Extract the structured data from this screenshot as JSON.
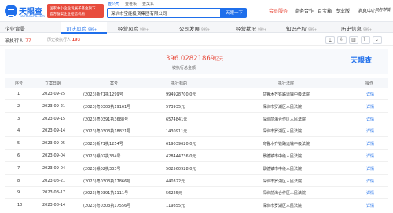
{
  "header": {
    "logo_name": "天眼查",
    "logo_domain": "TianYanCha.com",
    "promo_line1": "国家中小企业发展子基金旗下",
    "promo_line2": "官方备案企业征信机构",
    "search_tabs": [
      "查公司",
      "查老板",
      "查关系"
    ],
    "search_value": "深圳市宝能投资集团有限公司",
    "search_button": "天眼一下",
    "nav_vip": "会员服务",
    "nav_items": [
      "商务合作",
      "百宝箱",
      "专业版",
      "消息中心"
    ],
    "user_name": "马尔萨斯"
  },
  "tabs": [
    {
      "label": "企业背景",
      "count": ""
    },
    {
      "label": "司法风险",
      "count": "999+"
    },
    {
      "label": "经营风险",
      "count": "999+"
    },
    {
      "label": "公司发展",
      "count": "999+"
    },
    {
      "label": "经营状况",
      "count": "999+"
    },
    {
      "label": "知识产权",
      "count": "999+"
    },
    {
      "label": "历史信息",
      "count": "999+"
    }
  ],
  "subbar": {
    "title": "被执行人",
    "count": "77",
    "history_label": "历史被执行人",
    "history_count": "193"
  },
  "summary": {
    "amount": "396.02821869",
    "unit": "亿元",
    "label": "被执行总金额",
    "brand": "天眼查"
  },
  "table": {
    "headers": [
      "序号",
      "立案日期",
      "案号",
      "执行标的",
      "执行法院",
      "操作"
    ],
    "rows": [
      {
        "idx": "1",
        "date": "2023-09-25",
        "case": "(2023)新71执1299号",
        "amount": "994928700.0元",
        "court": "乌鲁木齐铁路运输中级法院",
        "link": "详情"
      },
      {
        "idx": "2",
        "date": "2023-09-21",
        "case": "(2023)粤0303执19161号",
        "amount": "573935元",
        "court": "深圳市罗湖区人民法院",
        "link": "详情"
      },
      {
        "idx": "3",
        "date": "2023-09-15",
        "case": "(2023)粤0391执3688号",
        "amount": "6574841元",
        "court": "深圳前海合作区人民法院",
        "link": "详情"
      },
      {
        "idx": "4",
        "date": "2023-09-14",
        "case": "(2023)粤0303执18821号",
        "amount": "1430911元",
        "court": "深圳市罗湖区人民法院",
        "link": "详情"
      },
      {
        "idx": "5",
        "date": "2023-09-05",
        "case": "(2023)新71执1254号",
        "amount": "619039620.0元",
        "court": "乌鲁木齐铁路运输中级法院",
        "link": "详情"
      },
      {
        "idx": "6",
        "date": "2023-09-04",
        "case": "(2023)赣02执334号",
        "amount": "428444736.0元",
        "court": "景德镇市中级人民法院",
        "link": "详情"
      },
      {
        "idx": "7",
        "date": "2023-09-04",
        "case": "(2023)赣02执333号",
        "amount": "502560928.0元",
        "court": "景德镇市中级人民法院",
        "link": "详情"
      },
      {
        "idx": "8",
        "date": "2023-08-21",
        "case": "(2023)粤0303执17866号",
        "amount": "440322元",
        "court": "深圳市罗湖区人民法院",
        "link": "详情"
      },
      {
        "idx": "9",
        "date": "2023-08-17",
        "case": "(2023)粤0391执1111号",
        "amount": "56225元",
        "court": "深圳前海合作区人民法院",
        "link": "详情"
      },
      {
        "idx": "10",
        "date": "2023-08-14",
        "case": "(2023)粤0303执17556号",
        "amount": "119855元",
        "court": "深圳市罗湖区人民法院",
        "link": "详情"
      }
    ]
  }
}
